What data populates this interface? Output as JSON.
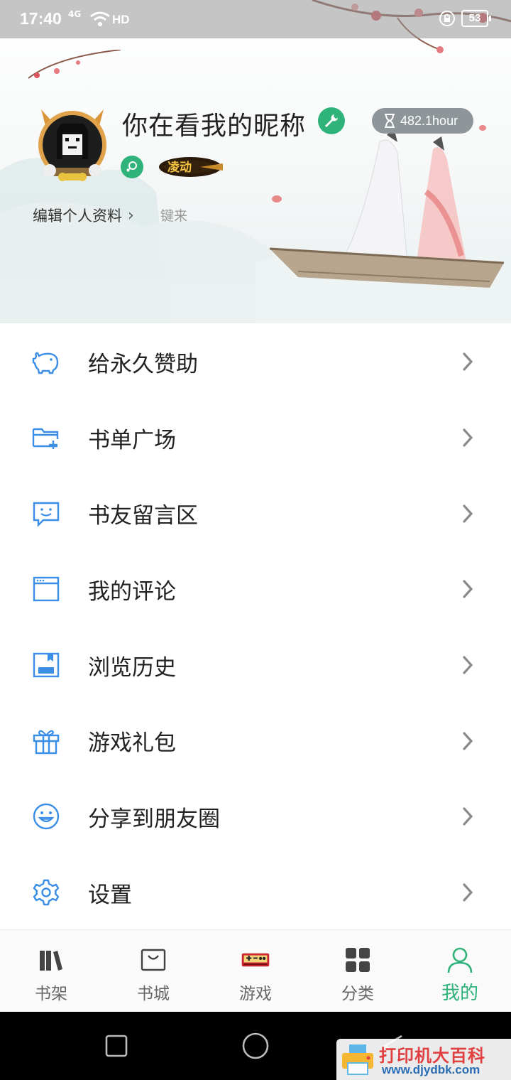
{
  "status_bar": {
    "time": "17:40",
    "network": "4G",
    "hd": "HD",
    "battery": "53"
  },
  "profile": {
    "nickname": "你在看我的昵称",
    "reading_time": "482.1hour",
    "edit_profile_label": "编辑个人资料",
    "signature": "键来",
    "level_badge_text": "凌动"
  },
  "menu": {
    "items": [
      {
        "label": "给永久赞助",
        "icon": "piggy-bank-icon"
      },
      {
        "label": "书单广场",
        "icon": "folder-add-icon"
      },
      {
        "label": "书友留言区",
        "icon": "chat-bubble-icon"
      },
      {
        "label": "我的评论",
        "icon": "browser-window-icon"
      },
      {
        "label": "浏览历史",
        "icon": "save-book-icon"
      },
      {
        "label": "游戏礼包",
        "icon": "gift-icon"
      },
      {
        "label": "分享到朋友圈",
        "icon": "smile-face-icon"
      },
      {
        "label": "设置",
        "icon": "gear-icon"
      }
    ]
  },
  "bottom_nav": {
    "items": [
      {
        "label": "书架",
        "icon": "bookshelf-icon"
      },
      {
        "label": "书城",
        "icon": "shopping-bag-icon"
      },
      {
        "label": "游戏",
        "icon": "game-console-icon"
      },
      {
        "label": "分类",
        "icon": "grid-icon"
      },
      {
        "label": "我的",
        "icon": "user-icon"
      }
    ],
    "active_index": 4
  },
  "watermark": {
    "title": "打印机大百科",
    "url": "www.djydbk.com"
  },
  "colors": {
    "accent": "#2fb37a",
    "icon_blue": "#3b8ee6",
    "chevron": "#8a8a8a"
  }
}
